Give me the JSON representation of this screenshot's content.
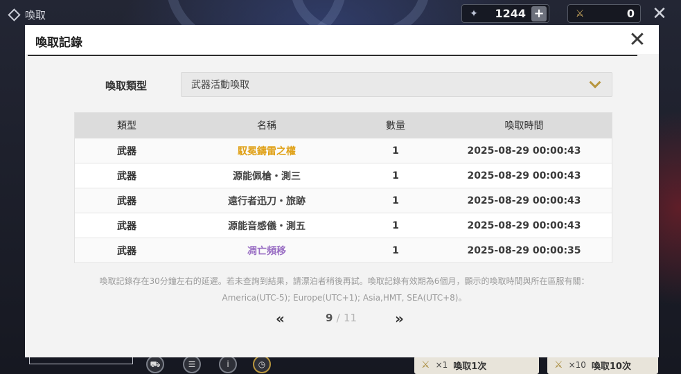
{
  "screen": {
    "title": "喚取",
    "currency": [
      {
        "icon": "star-pass-icon",
        "value": "1244"
      },
      {
        "icon": "weapon-pass-icon",
        "value": "0"
      }
    ]
  },
  "modal": {
    "title": "喚取記錄",
    "type_label": "喚取類型",
    "type_value": "武器活動喚取",
    "table": {
      "headers": [
        "類型",
        "名稱",
        "數量",
        "喚取時間"
      ],
      "rows": [
        {
          "type": "武器",
          "name": "馭冕鑄雷之權",
          "qty": "1",
          "time": "2025-08-29 00:00:43",
          "color": "#e0a21a"
        },
        {
          "type": "武器",
          "name": "源能佩槍・測三",
          "qty": "1",
          "time": "2025-08-29 00:00:43",
          "color": "#444444"
        },
        {
          "type": "武器",
          "name": "遠行者迅刀・旅跡",
          "qty": "1",
          "time": "2025-08-29 00:00:43",
          "color": "#444444"
        },
        {
          "type": "武器",
          "name": "源能音感儀・測五",
          "qty": "1",
          "time": "2025-08-29 00:00:43",
          "color": "#444444"
        },
        {
          "type": "武器",
          "name": "凋亡頻移",
          "qty": "1",
          "time": "2025-08-29 00:00:35",
          "color": "#9a6fc4"
        }
      ]
    },
    "note_line1": "喚取記錄存在30分鐘左右的延遲。若未查詢到結果，請漂泊者稍後再試。喚取記錄有效期為6個月，顯示的喚取時間與所在區服有關：",
    "note_line2": "America(UTC-5); Europe(UTC+1); Asia,HMT, SEA(UTC+8)。",
    "pagination": {
      "current": "9",
      "separator": "/",
      "total": "11"
    }
  },
  "bottom": {
    "draw1": {
      "mult": "×1",
      "label": "喚取1次"
    },
    "draw10": {
      "mult": "×10",
      "label": "喚取10次"
    }
  }
}
